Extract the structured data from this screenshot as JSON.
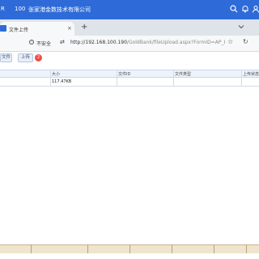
{
  "app_bar": {
    "left_fragment": "R",
    "number": "100",
    "company": "张家港金数技术有限公司",
    "icons": [
      "search-icon",
      "bell-icon",
      "user-icon"
    ]
  },
  "browser": {
    "tab_title": "文件上传",
    "tab_close": "×",
    "new_tab": "+",
    "security_label": "不安全",
    "url_main": "http://192.168.100.190",
    "url_rest": "/GoldBank/fileUpload.aspx?FormID=AP_I",
    "expand_icon": "chevron-down-icon"
  },
  "toolbar": {
    "file_button": "文件",
    "upload_button": "上传",
    "upload_badge": "2"
  },
  "table": {
    "columns": [
      "大小",
      "文件ID",
      "文件类型",
      "上传状态"
    ],
    "rows": [
      [
        "117.47KB",
        "",
        "",
        ""
      ]
    ]
  }
}
